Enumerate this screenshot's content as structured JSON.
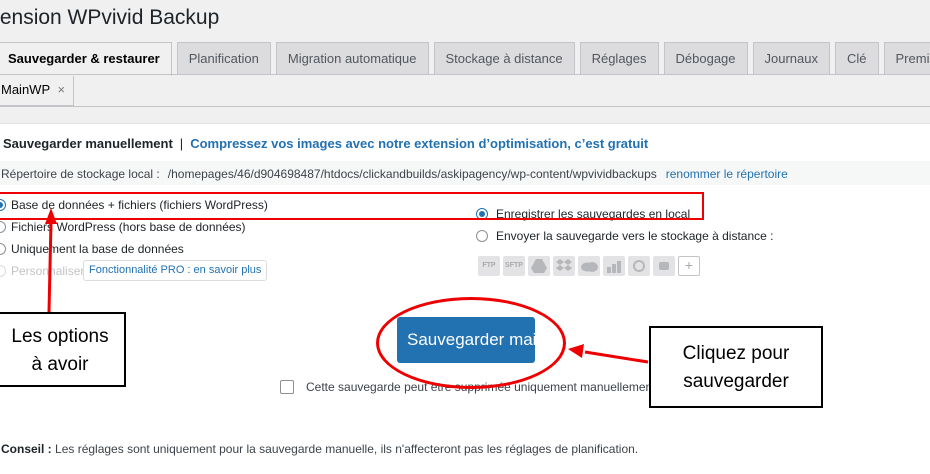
{
  "page": {
    "title": "tension WPvivid Backup"
  },
  "tabs": [
    {
      "label": "Sauvegarder & restaurer",
      "active": true
    },
    {
      "label": "Planification"
    },
    {
      "label": "Migration automatique"
    },
    {
      "label": "Stockage à distance"
    },
    {
      "label": "Réglages"
    },
    {
      "label": "Débogage"
    },
    {
      "label": "Journaux"
    },
    {
      "label": "Clé"
    },
    {
      "label": "Premium"
    }
  ],
  "secondary_tab": {
    "label": "MainWP",
    "close": "×"
  },
  "manual": {
    "heading": "Sauvegarder manuellement",
    "separator": "|",
    "promo": "Compressez vos images avec notre extension d’optimisation, c’est gratuit"
  },
  "directory": {
    "label": "Répertoire de stockage local :",
    "path": "/homepages/46/d904698487/htdocs/clickandbuilds/askipagency/wp-content/wpvividbackups",
    "rename_link": "renommer le répertoire"
  },
  "backup_options": [
    {
      "label": "Base de données + fichiers (fichiers WordPress)",
      "selected": true
    },
    {
      "label": "Fichiers WordPress (hors base de données)",
      "selected": false
    },
    {
      "label": "Uniquement la base de données",
      "selected": false
    },
    {
      "label": "Personnaliser",
      "selected": false,
      "disabled": true
    }
  ],
  "pro_link": "Fonctionnalité PRO : en savoir plus",
  "storage_options": [
    {
      "label": "Enregistrer les sauvegardes en local",
      "selected": true
    },
    {
      "label": "Envoyer la sauvegarde vers le stockage à distance :",
      "selected": false
    }
  ],
  "storage_icons": {
    "ftp": "FTP",
    "sftp": "SFTP",
    "plus": "+",
    "names": [
      "ftp-icon",
      "sftp-icon",
      "google-drive-icon",
      "dropbox-icon",
      "onedrive-icon",
      "s3-icon",
      "digitalocean-icon",
      "wasabi-icon",
      "add-storage-icon"
    ]
  },
  "backup_button": "Sauvegarder maintenant",
  "checkbox_label": "Cette sauvegarde peut être supprimée uniquement manuellement",
  "tip": {
    "label": "Conseil :",
    "text": "Les réglages sont uniquement pour la sauvegarde manuelle, ils n'affecteront pas les réglages de planification."
  },
  "annotations": {
    "left_callout": [
      "Les options",
      "à avoir"
    ],
    "right_callout": [
      "Cliquez pour",
      "sauvegarder"
    ],
    "color": "#ee0000"
  },
  "colors": {
    "accent": "#2271b1",
    "annotation": "#ee0000",
    "background": "#f0f0f1"
  }
}
